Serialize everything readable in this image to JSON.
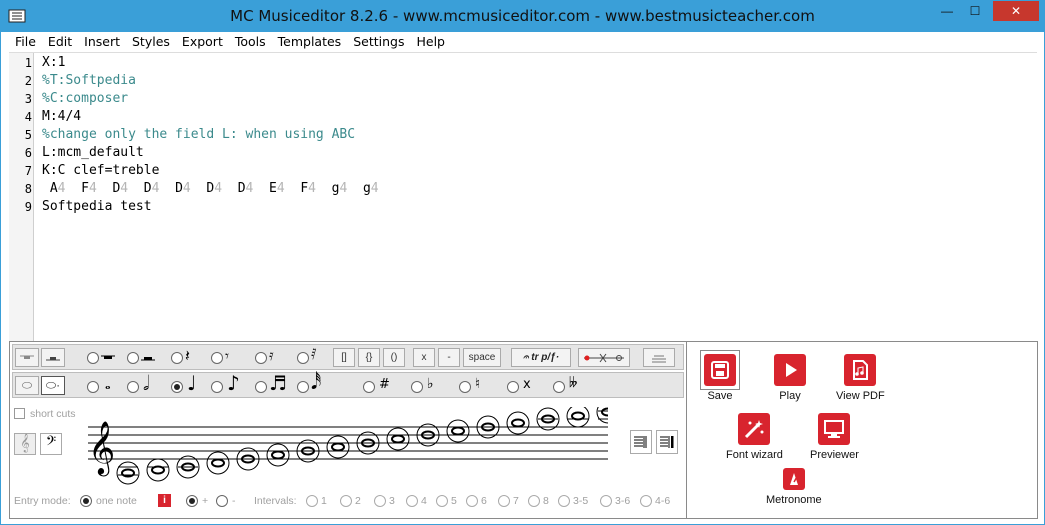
{
  "window": {
    "title": "MC Musiceditor 8.2.6 - www.mcmusiceditor.com - www.bestmusicteacher.com",
    "buttons": {
      "minimize": "—",
      "maximize": "☐",
      "close": "✕"
    }
  },
  "menu": [
    "File",
    "Edit",
    "Insert",
    "Styles",
    "Export",
    "Tools",
    "Templates",
    "Settings",
    "Help"
  ],
  "editor": {
    "lines": [
      {
        "no": "1",
        "text": "X:1",
        "style": "plain"
      },
      {
        "no": "2",
        "text": "%T:Softpedia",
        "style": "comment"
      },
      {
        "no": "3",
        "text": "%C:composer",
        "style": "comment"
      },
      {
        "no": "4",
        "text": "M:4/4",
        "style": "plain"
      },
      {
        "no": "5",
        "text": "%change only the field L: when using ABC",
        "style": "comment"
      },
      {
        "no": "6",
        "text": "L:mcm_default",
        "style": "plain"
      },
      {
        "no": "7",
        "text": "K:C clef=treble",
        "style": "plain"
      }
    ],
    "line8_no": "8",
    "notes": [
      {
        "n": "A",
        "d": "4"
      },
      {
        "n": "F",
        "d": "4"
      },
      {
        "n": "D",
        "d": "4"
      },
      {
        "n": "D",
        "d": "4"
      },
      {
        "n": "D",
        "d": "4"
      },
      {
        "n": "D",
        "d": "4"
      },
      {
        "n": "D",
        "d": "4"
      },
      {
        "n": "E",
        "d": "4"
      },
      {
        "n": "F",
        "d": "4"
      },
      {
        "n": "g",
        "d": "4"
      },
      {
        "n": "g",
        "d": "4"
      }
    ],
    "line9": {
      "no": "9",
      "text": "Softpedia test"
    }
  },
  "toolbar1": {
    "brackets": "[]",
    "braces": "{}",
    "parens": "()",
    "x": "x",
    "dash": "-",
    "space": "space",
    "ornaments": "𝄐 tr p/ƒ·"
  },
  "toolbar2": {
    "sharp": "#",
    "flat": "♭",
    "natural": "♮",
    "dsharp": "x",
    "dflat": "𝄫"
  },
  "notation": {
    "short_cuts": "short cuts",
    "treble_clef": "𝄞",
    "bass_clef": "𝄢",
    "entry_mode_label": "Entry mode:",
    "one_note": "one note",
    "info": "i",
    "plus": "+",
    "minus": "-",
    "intervals_label": "Intervals:",
    "intervals": [
      "1",
      "2",
      "3",
      "4",
      "5",
      "6",
      "7",
      "8",
      "3-5",
      "3-6",
      "4-6"
    ]
  },
  "actions": {
    "save": "Save",
    "play": "Play",
    "view_pdf": "View PDF",
    "font_wizard": "Font wizard",
    "previewer": "Previewer",
    "metronome": "Metronome"
  },
  "colors": {
    "titlebar": "#3a9fd8",
    "accent_red": "#d8242e",
    "comment": "#3b8a8c",
    "close": "#c7372d"
  }
}
